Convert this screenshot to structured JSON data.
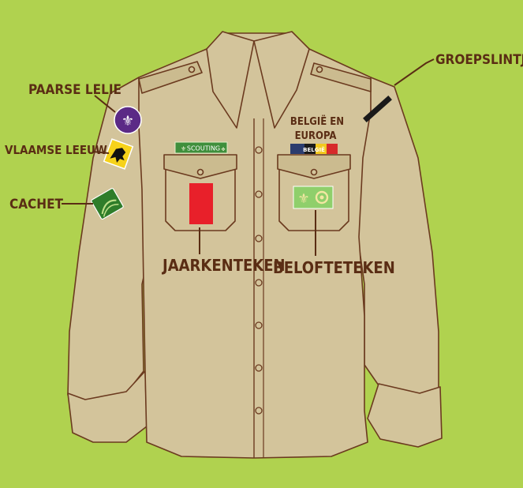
{
  "labels": {
    "paarse_lelie": "PAARSE LELIE",
    "vlaamse_leeuw": "VLAAMSE LEEUW",
    "cachet": "CACHET",
    "groepslintje": "GROEPSLINTJE",
    "jaarkenteken": "JAARKENTEKEN",
    "belofteteken": "BELOFTETEKEN",
    "belgie_line1": "BELGIË EN",
    "belgie_line2": "EUROPA"
  },
  "badges": {
    "scouting_strip": "SCOUTING",
    "belgie_strip": "BELGIË"
  },
  "colors": {
    "background": "#b0d24f",
    "shirt": "#d3c49b",
    "outline": "#5a2d14",
    "jaarkenteken": "#e8202a",
    "lelie_purple": "#5b2a86",
    "cachet_green": "#2f7d2a",
    "groepslint": "#1a1a1a"
  }
}
